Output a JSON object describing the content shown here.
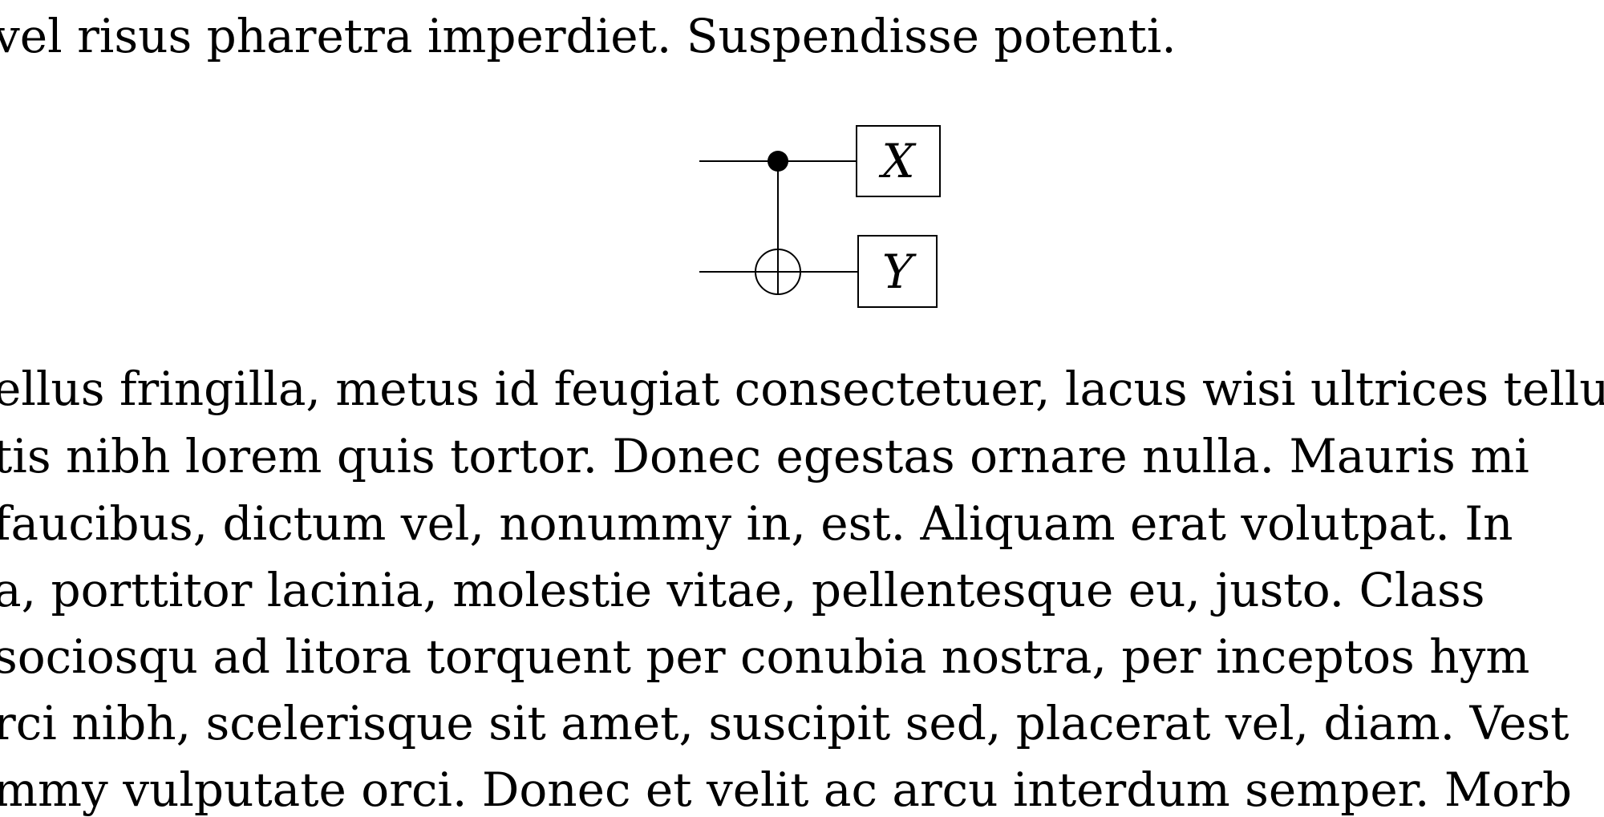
{
  "page": {
    "top_line": "vel risus pharetra imperdiet. Suspendisse potenti.",
    "paragraph": [
      "ellus fringilla, metus id feugiat consectetuer, lacus wisi ultrices tellu",
      "tis nibh lorem quis tortor. Donec egestas ornare nulla. Mauris mi",
      " faucibus, dictum vel, nonummy in, est. Aliquam erat volutpat. In",
      "a, porttitor lacinia, molestie vitae, pellentesque eu, justo. Class",
      " sociosqu ad litora torquent per conubia nostra, per inceptos hym",
      "rci nibh, scelerisque sit amet, suscipit sed, placerat vel, diam. Vest",
      "mmy vulputate orci. Donec et velit ac arcu interdum semper. Morb"
    ]
  },
  "circuit": {
    "gate_top": "X",
    "gate_bottom": "Y"
  }
}
